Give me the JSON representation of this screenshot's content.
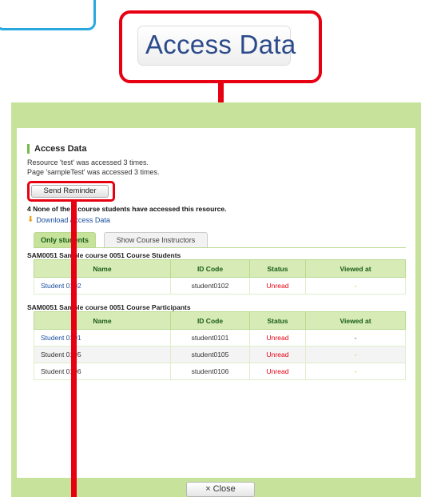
{
  "callout": {
    "zoomed_label": "Access Data"
  },
  "dialog": {
    "title": "Access Data",
    "resource_line": "Resource 'test' was accessed 3 times.",
    "page_line": "Page 'sampleTest' was accessed 3 times.",
    "send_reminder_label": "Send Reminder",
    "summary": "4 None of the 4 course students have accessed this resource.",
    "download_label": "Download Access Data",
    "tabs": [
      {
        "label": "Only students",
        "active": true
      },
      {
        "label": "Show Course Instructors",
        "active": false
      }
    ],
    "groups": [
      {
        "title": "SAM0051 Sample course 0051 Course Students",
        "columns": [
          "Name",
          "ID Code",
          "Status",
          "Viewed at"
        ],
        "rows": [
          {
            "name": "Student 0102",
            "id_code": "student0102",
            "status": "Unread",
            "viewed_at": "-"
          }
        ]
      },
      {
        "title": "SAM0051 Sample course 0051 Course Participants",
        "columns": [
          "Name",
          "ID Code",
          "Status",
          "Viewed at"
        ],
        "rows": [
          {
            "name": "Student 0101",
            "id_code": "student0101",
            "status": "Unread",
            "viewed_at": "-"
          },
          {
            "name": "Student 0105",
            "id_code": "student0105",
            "status": "Unread",
            "viewed_at": "-"
          },
          {
            "name": "Student 0106",
            "id_code": "student0106",
            "status": "Unread",
            "viewed_at": "-"
          }
        ]
      }
    ],
    "close_label": "× Close"
  },
  "colors": {
    "accent_red": "#e60012",
    "dialog_green": "#c7e39b",
    "link_blue": "#1a4f9c"
  }
}
